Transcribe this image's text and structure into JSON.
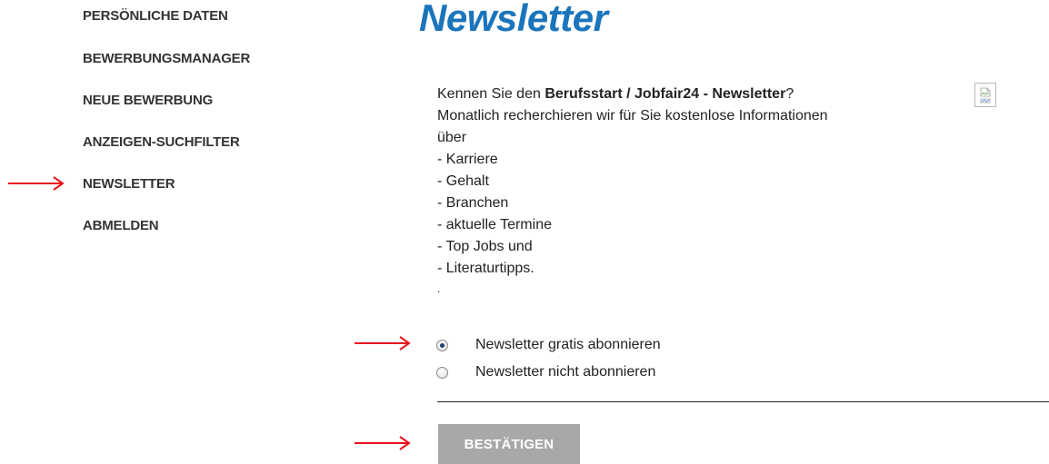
{
  "sidebar": {
    "items": [
      {
        "label": "PERSÖNLICHE DATEN"
      },
      {
        "label": "BEWERBUNGSMANAGER"
      },
      {
        "label": "NEUE BEWERBUNG"
      },
      {
        "label": "ANZEIGEN-SUCHFILTER"
      },
      {
        "label": "NEWSLETTER"
      },
      {
        "label": "ABMELDEN"
      }
    ]
  },
  "main": {
    "title": "Newsletter",
    "intro": {
      "question_prefix": "Kennen Sie den ",
      "question_bold": "Berufsstart / Jobfair24 - Newsletter",
      "question_suffix": "?",
      "line2": "Monatlich recherchieren wir für Sie kostenlose Informationen",
      "line3": "über",
      "topics": [
        "- Karriere",
        "- Gehalt",
        "- Branchen",
        "- aktuelle Termine",
        "- Top Jobs und",
        "- Literaturtipps."
      ],
      "trailing": "."
    },
    "options": [
      {
        "label": "Newsletter gratis abonnieren",
        "selected": true
      },
      {
        "label": "Newsletter nicht abonnieren",
        "selected": false
      }
    ],
    "confirm_label": "BESTÄTIGEN"
  },
  "colors": {
    "title": "#1a75bc",
    "arrow": "#e8141b",
    "button": "#a8a8a8"
  },
  "icons": {
    "image": "broken-image-icon",
    "arrow": "red-arrow-icon"
  }
}
